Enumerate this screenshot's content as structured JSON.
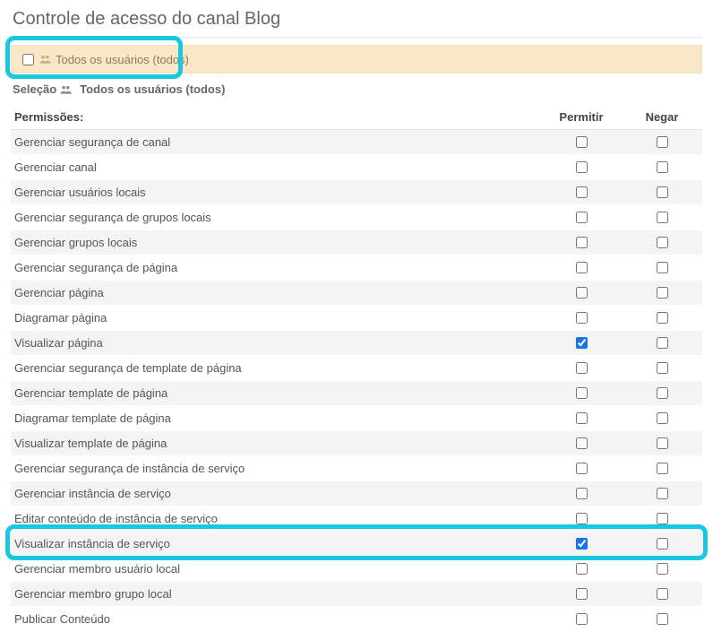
{
  "title": "Controle de acesso do canal Blog",
  "groupBar": {
    "label": "Todos os usuários (todos)"
  },
  "selection": {
    "prefix": "Seleção",
    "group": "Todos os usuários (todos)"
  },
  "headers": {
    "permissions": "Permissões:",
    "allow": "Permitir",
    "deny": "Negar"
  },
  "rows": [
    {
      "label": "Gerenciar segurança de canal",
      "allow": false,
      "deny": false
    },
    {
      "label": "Gerenciar canal",
      "allow": false,
      "deny": false
    },
    {
      "label": "Gerenciar usuários locais",
      "allow": false,
      "deny": false
    },
    {
      "label": "Gerenciar segurança de grupos locais",
      "allow": false,
      "deny": false
    },
    {
      "label": "Gerenciar grupos locais",
      "allow": false,
      "deny": false
    },
    {
      "label": "Gerenciar segurança de página",
      "allow": false,
      "deny": false
    },
    {
      "label": "Gerenciar página",
      "allow": false,
      "deny": false
    },
    {
      "label": "Diagramar página",
      "allow": false,
      "deny": false
    },
    {
      "label": "Visualizar página",
      "allow": true,
      "deny": false
    },
    {
      "label": "Gerenciar segurança de template de página",
      "allow": false,
      "deny": false
    },
    {
      "label": "Gerenciar template de página",
      "allow": false,
      "deny": false
    },
    {
      "label": "Diagramar template de página",
      "allow": false,
      "deny": false
    },
    {
      "label": "Visualizar template de página",
      "allow": false,
      "deny": false
    },
    {
      "label": "Gerenciar segurança de instância de serviço",
      "allow": false,
      "deny": false
    },
    {
      "label": "Gerenciar instância de serviço",
      "allow": false,
      "deny": false
    },
    {
      "label": "Editar conteúdo de instância de serviço",
      "allow": false,
      "deny": false
    },
    {
      "label": "Visualizar instância de serviço",
      "allow": true,
      "deny": false
    },
    {
      "label": "Gerenciar membro usuário local",
      "allow": false,
      "deny": false
    },
    {
      "label": "Gerenciar membro grupo local",
      "allow": false,
      "deny": false
    },
    {
      "label": "Publicar Conteúdo",
      "allow": false,
      "deny": false
    }
  ],
  "highlightRowIndex": 16
}
